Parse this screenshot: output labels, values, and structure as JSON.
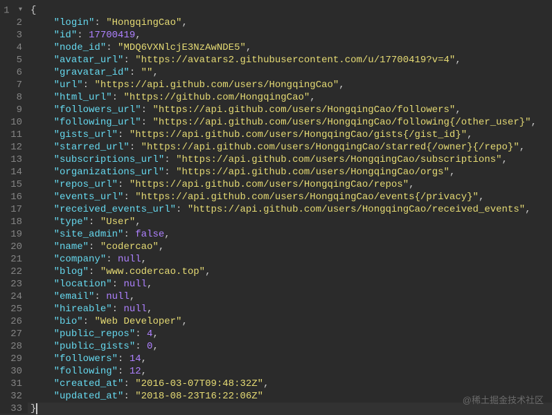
{
  "editor": {
    "line_count": 33,
    "fold_open_line": 1,
    "active_line": 33,
    "watermark": "@稀土掘金技术社区",
    "json_lines": [
      {
        "text": "{",
        "type": "brace"
      },
      {
        "indent": 1,
        "key": "login",
        "kind": "string",
        "value": "HongqingCao"
      },
      {
        "indent": 1,
        "key": "id",
        "kind": "number",
        "value": "17700419"
      },
      {
        "indent": 1,
        "key": "node_id",
        "kind": "string",
        "value": "MDQ6VXNlcjE3NzAwNDE5"
      },
      {
        "indent": 1,
        "key": "avatar_url",
        "kind": "string",
        "value": "https://avatars2.githubusercontent.com/u/17700419?v=4"
      },
      {
        "indent": 1,
        "key": "gravatar_id",
        "kind": "string",
        "value": ""
      },
      {
        "indent": 1,
        "key": "url",
        "kind": "string",
        "value": "https://api.github.com/users/HongqingCao"
      },
      {
        "indent": 1,
        "key": "html_url",
        "kind": "string",
        "value": "https://github.com/HongqingCao"
      },
      {
        "indent": 1,
        "key": "followers_url",
        "kind": "string",
        "value": "https://api.github.com/users/HongqingCao/followers"
      },
      {
        "indent": 1,
        "key": "following_url",
        "kind": "string",
        "value": "https://api.github.com/users/HongqingCao/following{/other_user}"
      },
      {
        "indent": 1,
        "key": "gists_url",
        "kind": "string",
        "value": "https://api.github.com/users/HongqingCao/gists{/gist_id}"
      },
      {
        "indent": 1,
        "key": "starred_url",
        "kind": "string",
        "value": "https://api.github.com/users/HongqingCao/starred{/owner}{/repo}"
      },
      {
        "indent": 1,
        "key": "subscriptions_url",
        "kind": "string",
        "value": "https://api.github.com/users/HongqingCao/subscriptions"
      },
      {
        "indent": 1,
        "key": "organizations_url",
        "kind": "string",
        "value": "https://api.github.com/users/HongqingCao/orgs"
      },
      {
        "indent": 1,
        "key": "repos_url",
        "kind": "string",
        "value": "https://api.github.com/users/HongqingCao/repos"
      },
      {
        "indent": 1,
        "key": "events_url",
        "kind": "string",
        "value": "https://api.github.com/users/HongqingCao/events{/privacy}"
      },
      {
        "indent": 1,
        "key": "received_events_url",
        "kind": "string",
        "value": "https://api.github.com/users/HongqingCao/received_events"
      },
      {
        "indent": 1,
        "key": "type",
        "kind": "string",
        "value": "User"
      },
      {
        "indent": 1,
        "key": "site_admin",
        "kind": "keyword",
        "value": "false"
      },
      {
        "indent": 1,
        "key": "name",
        "kind": "string",
        "value": "codercao"
      },
      {
        "indent": 1,
        "key": "company",
        "kind": "keyword",
        "value": "null"
      },
      {
        "indent": 1,
        "key": "blog",
        "kind": "string",
        "value": "www.codercao.top"
      },
      {
        "indent": 1,
        "key": "location",
        "kind": "keyword",
        "value": "null"
      },
      {
        "indent": 1,
        "key": "email",
        "kind": "keyword",
        "value": "null"
      },
      {
        "indent": 1,
        "key": "hireable",
        "kind": "keyword",
        "value": "null"
      },
      {
        "indent": 1,
        "key": "bio",
        "kind": "string",
        "value": "Web Developer"
      },
      {
        "indent": 1,
        "key": "public_repos",
        "kind": "number",
        "value": "4"
      },
      {
        "indent": 1,
        "key": "public_gists",
        "kind": "number",
        "value": "0"
      },
      {
        "indent": 1,
        "key": "followers",
        "kind": "number",
        "value": "14"
      },
      {
        "indent": 1,
        "key": "following",
        "kind": "number",
        "value": "12"
      },
      {
        "indent": 1,
        "key": "created_at",
        "kind": "string",
        "value": "2016-03-07T09:48:32Z"
      },
      {
        "indent": 1,
        "key": "updated_at",
        "kind": "string",
        "value": "2018-08-23T16:22:06Z",
        "last": true
      },
      {
        "text": "}",
        "type": "brace",
        "cursor": true
      }
    ]
  }
}
